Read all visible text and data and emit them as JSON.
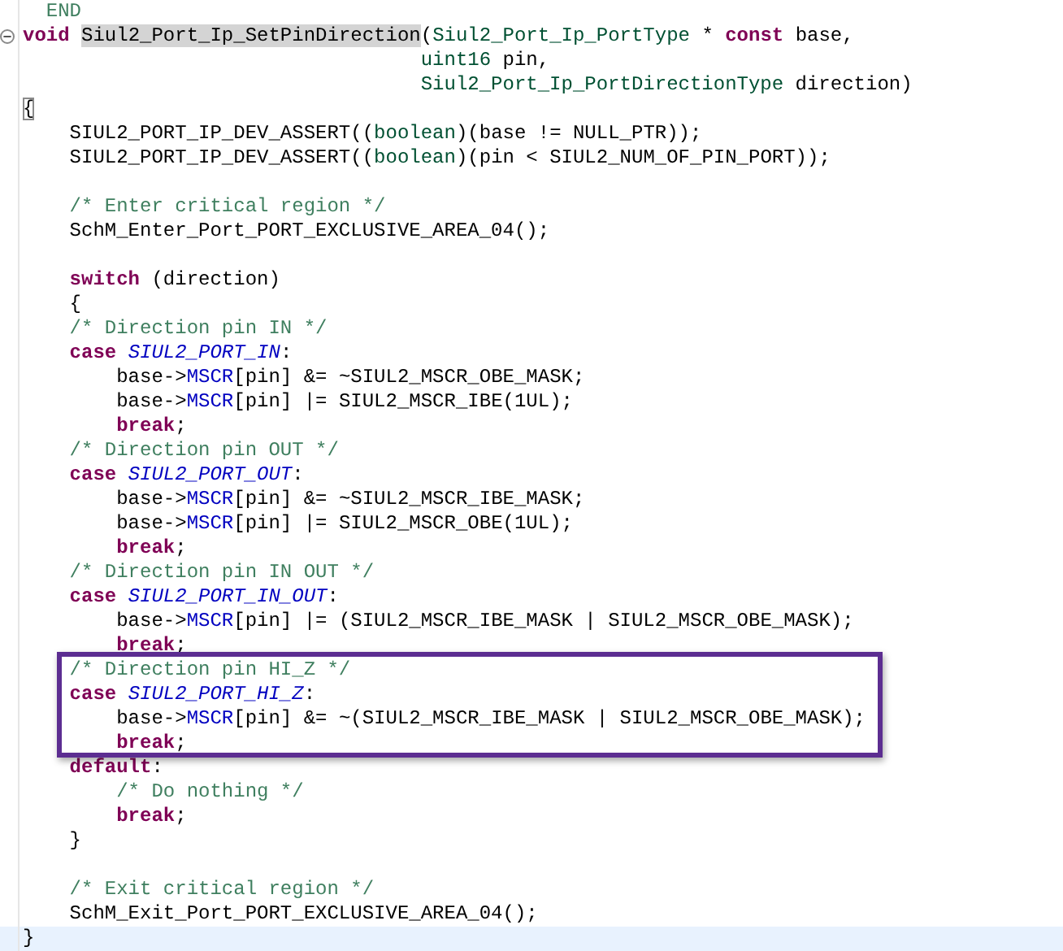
{
  "editor": {
    "lines": [
      {
        "kind": "code",
        "tokens": [
          {
            "text": "  END",
            "kind": "comment"
          }
        ]
      },
      {
        "kind": "code",
        "foldable": true,
        "tokens": [
          {
            "text": "void ",
            "kind": "keyword"
          },
          {
            "text": "Siul2_Port_Ip_SetPinDirection",
            "kind": "plain",
            "marked": true
          },
          {
            "text": "(",
            "kind": "plain"
          },
          {
            "text": "Siul2_Port_Ip_PortType",
            "kind": "type"
          },
          {
            "text": " * ",
            "kind": "plain"
          },
          {
            "text": "const",
            "kind": "keyword"
          },
          {
            "text": " base,",
            "kind": "plain"
          }
        ]
      },
      {
        "kind": "code",
        "tokens": [
          {
            "text": "                                  uint16",
            "kind": "type"
          },
          {
            "text": " pin,",
            "kind": "plain"
          }
        ]
      },
      {
        "kind": "code",
        "tokens": [
          {
            "text": "                                  Siul2_Port_Ip_PortDirectionType",
            "kind": "type"
          },
          {
            "text": " direction)",
            "kind": "plain"
          }
        ]
      },
      {
        "kind": "code",
        "tokens": [
          {
            "text": "{",
            "kind": "plain",
            "matched": true
          }
        ]
      },
      {
        "kind": "code",
        "tokens": [
          {
            "text": "    SIUL2_PORT_IP_DEV_ASSERT((",
            "kind": "plain"
          },
          {
            "text": "boolean",
            "kind": "type"
          },
          {
            "text": ")(base != NULL_PTR));",
            "kind": "plain"
          }
        ]
      },
      {
        "kind": "code",
        "tokens": [
          {
            "text": "    SIUL2_PORT_IP_DEV_ASSERT((",
            "kind": "plain"
          },
          {
            "text": "boolean",
            "kind": "type"
          },
          {
            "text": ")(pin < SIUL2_NUM_OF_PIN_PORT));",
            "kind": "plain"
          }
        ]
      },
      {
        "kind": "blank"
      },
      {
        "kind": "code",
        "tokens": [
          {
            "text": "    /* Enter critical region */",
            "kind": "comment"
          }
        ]
      },
      {
        "kind": "code",
        "tokens": [
          {
            "text": "    SchM_Enter_Port_PORT_EXCLUSIVE_AREA_04();",
            "kind": "plain"
          }
        ]
      },
      {
        "kind": "blank"
      },
      {
        "kind": "code",
        "tokens": [
          {
            "text": "    switch",
            "kind": "keyword"
          },
          {
            "text": " (direction)",
            "kind": "plain"
          }
        ]
      },
      {
        "kind": "code",
        "tokens": [
          {
            "text": "    {",
            "kind": "plain"
          }
        ]
      },
      {
        "kind": "code",
        "tokens": [
          {
            "text": "    /* Direction pin IN */",
            "kind": "comment"
          }
        ]
      },
      {
        "kind": "code",
        "tokens": [
          {
            "text": "    case ",
            "kind": "keyword"
          },
          {
            "text": "SIUL2_PORT_IN",
            "kind": "enum"
          },
          {
            "text": ":",
            "kind": "plain"
          }
        ]
      },
      {
        "kind": "code",
        "tokens": [
          {
            "text": "        base->",
            "kind": "plain"
          },
          {
            "text": "MSCR",
            "kind": "field"
          },
          {
            "text": "[pin] &= ~SIUL2_MSCR_OBE_MASK;",
            "kind": "plain"
          }
        ]
      },
      {
        "kind": "code",
        "tokens": [
          {
            "text": "        base->",
            "kind": "plain"
          },
          {
            "text": "MSCR",
            "kind": "field"
          },
          {
            "text": "[pin] |= SIUL2_MSCR_IBE(1UL);",
            "kind": "plain"
          }
        ]
      },
      {
        "kind": "code",
        "tokens": [
          {
            "text": "        break",
            "kind": "keyword"
          },
          {
            "text": ";",
            "kind": "plain"
          }
        ]
      },
      {
        "kind": "code",
        "tokens": [
          {
            "text": "    /* Direction pin OUT */",
            "kind": "comment"
          }
        ]
      },
      {
        "kind": "code",
        "tokens": [
          {
            "text": "    case ",
            "kind": "keyword"
          },
          {
            "text": "SIUL2_PORT_OUT",
            "kind": "enum"
          },
          {
            "text": ":",
            "kind": "plain"
          }
        ]
      },
      {
        "kind": "code",
        "tokens": [
          {
            "text": "        base->",
            "kind": "plain"
          },
          {
            "text": "MSCR",
            "kind": "field"
          },
          {
            "text": "[pin] &= ~SIUL2_MSCR_IBE_MASK;",
            "kind": "plain"
          }
        ]
      },
      {
        "kind": "code",
        "tokens": [
          {
            "text": "        base->",
            "kind": "plain"
          },
          {
            "text": "MSCR",
            "kind": "field"
          },
          {
            "text": "[pin] |= SIUL2_MSCR_OBE(1UL);",
            "kind": "plain"
          }
        ]
      },
      {
        "kind": "code",
        "tokens": [
          {
            "text": "        break",
            "kind": "keyword"
          },
          {
            "text": ";",
            "kind": "plain"
          }
        ]
      },
      {
        "kind": "code",
        "tokens": [
          {
            "text": "    /* Direction pin IN OUT */",
            "kind": "comment"
          }
        ]
      },
      {
        "kind": "code",
        "tokens": [
          {
            "text": "    case ",
            "kind": "keyword"
          },
          {
            "text": "SIUL2_PORT_IN_OUT",
            "kind": "enum"
          },
          {
            "text": ":",
            "kind": "plain"
          }
        ]
      },
      {
        "kind": "code",
        "tokens": [
          {
            "text": "        base->",
            "kind": "plain"
          },
          {
            "text": "MSCR",
            "kind": "field"
          },
          {
            "text": "[pin] |= (SIUL2_MSCR_IBE_MASK | SIUL2_MSCR_OBE_MASK);",
            "kind": "plain"
          }
        ]
      },
      {
        "kind": "code",
        "tokens": [
          {
            "text": "        break",
            "kind": "keyword"
          },
          {
            "text": ";",
            "kind": "plain"
          }
        ]
      },
      {
        "kind": "code",
        "framed": true,
        "tokens": [
          {
            "text": "    /* Direction pin HI_Z */",
            "kind": "comment"
          }
        ]
      },
      {
        "kind": "code",
        "framed": true,
        "tokens": [
          {
            "text": "    case ",
            "kind": "keyword"
          },
          {
            "text": "SIUL2_PORT_HI_Z",
            "kind": "enum"
          },
          {
            "text": ":",
            "kind": "plain"
          }
        ]
      },
      {
        "kind": "code",
        "framed": true,
        "tokens": [
          {
            "text": "        base->",
            "kind": "plain"
          },
          {
            "text": "MSCR",
            "kind": "field"
          },
          {
            "text": "[pin] &= ~(SIUL2_MSCR_IBE_MASK | SIUL2_MSCR_OBE_MASK);",
            "kind": "plain"
          }
        ]
      },
      {
        "kind": "code",
        "framed": true,
        "tokens": [
          {
            "text": "        break",
            "kind": "keyword"
          },
          {
            "text": ";",
            "kind": "plain"
          }
        ]
      },
      {
        "kind": "code",
        "tokens": [
          {
            "text": "    default",
            "kind": "keyword"
          },
          {
            "text": ":",
            "kind": "plain"
          }
        ]
      },
      {
        "kind": "code",
        "tokens": [
          {
            "text": "        /* Do nothing */",
            "kind": "comment"
          }
        ]
      },
      {
        "kind": "code",
        "tokens": [
          {
            "text": "        break",
            "kind": "keyword"
          },
          {
            "text": ";",
            "kind": "plain"
          }
        ]
      },
      {
        "kind": "code",
        "tokens": [
          {
            "text": "    }",
            "kind": "plain"
          }
        ]
      },
      {
        "kind": "blank"
      },
      {
        "kind": "code",
        "tokens": [
          {
            "text": "    /* Exit critical region */",
            "kind": "comment"
          }
        ]
      },
      {
        "kind": "code",
        "tokens": [
          {
            "text": "    SchM_Exit_Port_PORT_EXCLUSIVE_AREA_04();",
            "kind": "plain"
          }
        ]
      },
      {
        "kind": "code",
        "current": true,
        "tokens": [
          {
            "text": "}",
            "kind": "plain"
          }
        ]
      }
    ]
  }
}
